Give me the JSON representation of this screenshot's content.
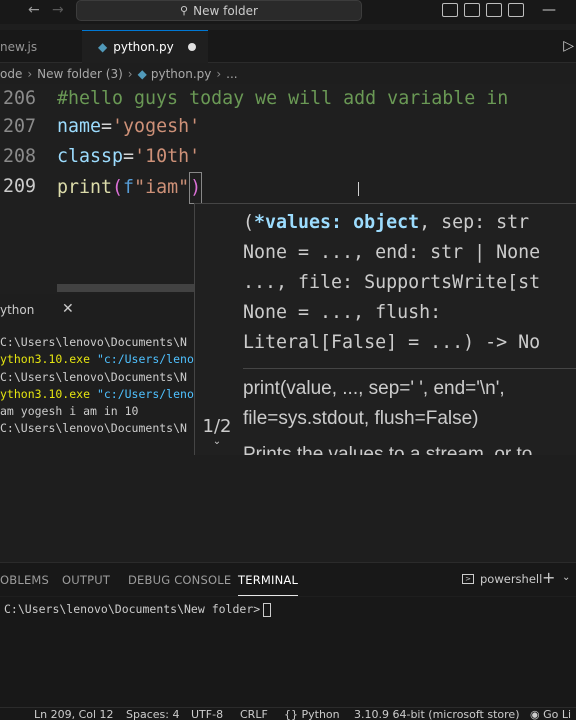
{
  "titlebar": {
    "back_icon": "arrow-left-icon",
    "forward_icon": "arrow-right-icon",
    "search_icon": "search-icon",
    "search_label": "New folder"
  },
  "tabs": [
    {
      "label": "new.js",
      "active": false
    },
    {
      "label": "python.py",
      "active": true,
      "dirty": true
    }
  ],
  "breadcrumb": {
    "items": [
      "ode",
      "New folder (3)",
      "python.py",
      "..."
    ]
  },
  "editor": {
    "lines": [
      {
        "number": "206",
        "text": "#hello guys today we will add variable in"
      },
      {
        "number": "207",
        "var": "name",
        "op": "=",
        "value": "'yogesh'"
      },
      {
        "number": "208",
        "var": "classp",
        "op": "=",
        "value": "'10th'"
      },
      {
        "number": "209",
        "fn": "print",
        "open": "(",
        "prefix": "f",
        "value": "\"iam\"",
        "close": ")"
      }
    ]
  },
  "output_pane": {
    "title": "ython",
    "lines": [
      {
        "a": "C:\\Users\\lenovo\\Documents\\N",
        "kind": "plain"
      },
      {
        "a": "ython3.10.exe",
        "b": " \"c:/Users/leno",
        "kind": "yc"
      },
      {
        "a": "C:\\Users\\lenovo\\Documents\\N",
        "kind": "plain"
      },
      {
        "a": "ython3.10.exe",
        "b": " \"c:/Users/leno",
        "kind": "yc"
      },
      {
        "a": "am yogesh i am in 10",
        "kind": "plain"
      },
      {
        "a": "C:\\Users\\lenovo\\Documents\\N",
        "kind": "plain"
      }
    ]
  },
  "signature_help": {
    "pager": "1/2",
    "sig_line1_open": "(",
    "sig_line1_param": "*values: object",
    "sig_line1_rest": ", sep: str",
    "sig_line2": "None = ..., end: str | None",
    "sig_line3": "..., file: SupportsWrite[st",
    "sig_line4": "None = ..., flush:",
    "sig_line5": "Literal[False] = ...) -> No",
    "doc_line1": "print(value, ..., sep=' ', end='\\n',",
    "doc_line2": "file=sys.stdout, flush=False)",
    "doc_line3": "Prints the values to a stream, or to"
  },
  "panel": {
    "tabs": [
      "OBLEMS",
      "OUTPUT",
      "DEBUG CONSOLE",
      "TERMINAL"
    ],
    "active_tab": "TERMINAL",
    "shell": "powershell",
    "prompt": "C:\\Users\\lenovo\\Documents\\New folder>"
  },
  "statusbar": {
    "position": "Ln 209, Col 12",
    "spaces": "Spaces: 4",
    "encoding": "UTF-8",
    "eol": "CRLF",
    "language": "Python",
    "interpreter": "3.10.9 64-bit (microsoft store)",
    "golive": "Go Li"
  }
}
